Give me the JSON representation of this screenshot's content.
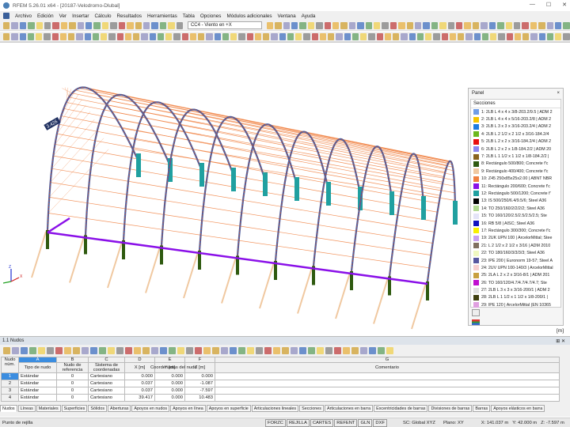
{
  "window": {
    "title": "RFEM 5.26.01 x64 - [20187-Velodromo-Dlubal]"
  },
  "menu": [
    "Archivo",
    "Edición",
    "Ver",
    "Insertar",
    "Cálculo",
    "Resultados",
    "Herramientas",
    "Tabla",
    "Opciones",
    "Módulos adicionales",
    "Ventana",
    "Ayuda"
  ],
  "toolbar": {
    "load_case": "CC4 - Viento en +X"
  },
  "viewport": {
    "units": "[m]",
    "dimension_label": "3.426"
  },
  "panel": {
    "title": "Panel",
    "close": "×",
    "heading": "Secciones",
    "sections": [
      {
        "label": "1: 2LB L 4 x 4 x 3/8-203.2/9.5 | ADM 2",
        "color": "#6f9de8"
      },
      {
        "label": "2: 2LB L 4 x 4 x 5/16-203.2/8 | ADM 2",
        "color": "#f5c400"
      },
      {
        "label": "3: 2LB L 3 x 3 x 3/16-203.2/4 | ADM 2",
        "color": "#1e7be0"
      },
      {
        "label": "4: 2LB L 2 1/2 x 2 1/2 x 3/16-184.2/4",
        "color": "#6cb81e"
      },
      {
        "label": "5: 2LB L 2 x 2 x 3/16-184.2/4 | ADM 2",
        "color": "#e81010"
      },
      {
        "label": "6: 2LB L 2 x 2 x 1/8-184.2/2 | ADM 20",
        "color": "#8c86f0"
      },
      {
        "label": "7: 2LB L 1 1/2 x 1 1/2 x 1/8-184.2/2 |",
        "color": "#8a6420"
      },
      {
        "label": "8: Rectángulo 500/800; Concrete f'c",
        "color": "#2f5a10"
      },
      {
        "label": "9: Rectángulo 400/400; Concrete f'c",
        "color": "#f0c8a0"
      },
      {
        "label": "10: Z45 250x85x25x2.00 | ABNT NBR",
        "color": "#f08040"
      },
      {
        "label": "11: Rectángulo 200/600; Concrete f'c",
        "color": "#8a10e8"
      },
      {
        "label": "12: Rectángulo 500/1200; Concrete f'",
        "color": "#20a0a0"
      },
      {
        "label": "13: IS 500/250/6.4/9.5/6; Steel A36",
        "color": "#000000"
      },
      {
        "label": "14: TO 250/160/2/2/2/2; Steel A36",
        "color": "#b0d890"
      },
      {
        "label": "15: TO 160/120/2.5/2.5/2.5/2.5; Ste",
        "color": "#e4e4f8"
      },
      {
        "label": "16: RB 5/8 | AISC; Steel A36",
        "color": "#1010c0"
      },
      {
        "label": "17: Rectángulo 300/300; Concrete f'c",
        "color": "#f8f000"
      },
      {
        "label": "19: 2UK UPN 100 | ArcelorMittal; Stee",
        "color": "#c8a0f0"
      },
      {
        "label": "21: L 2 1/2 x 2 1/2 x 3/16 | ADM 2010",
        "color": "#807060"
      },
      {
        "label": "22: TO 180/160/3/3/3/3; Steel A36",
        "color": "#f0f8c0"
      },
      {
        "label": "23: IPE 200 | Euronorm 19-57; Steel A",
        "color": "#5858a0"
      },
      {
        "label": "24: 2UV UPN 100-140/3 | ArcelorMittal",
        "color": "#f8d0d0"
      },
      {
        "label": "25: 2LA L 2 x 2 x 3/16-8/1 | ADM 201",
        "color": "#c8a040"
      },
      {
        "label": "26: TO 160/120/4.7/4.7/4.7/4.7; Ste",
        "color": "#c010d0"
      },
      {
        "label": "27: 2LB L 3 x 3 x 3/16-200/1 | ADM 2",
        "color": "#e0e0e0"
      },
      {
        "label": "28: 2LB L 1 1/2 x 1 1/2 x 1/8-200/1 |",
        "color": "#404010"
      },
      {
        "label": "29: IPE 120 | ArcelorMittal (EN 10365",
        "color": "#e0a0e0"
      }
    ]
  },
  "table": {
    "title": "1.1 Nudos",
    "col_letters": [
      "A",
      "B",
      "C",
      "D",
      "E",
      "F",
      "G"
    ],
    "headers": {
      "node_no": "Nudo núm.",
      "type": "Tipo de nudo",
      "ref": "Nudo de referencia",
      "coord_sys": "Sistema de coordenadas",
      "coords": "Coordenadas del nudo",
      "x": "X [m]",
      "y": "Y [m]",
      "z": "Z [m]",
      "comment": "Comentario"
    },
    "rows": [
      {
        "no": "1",
        "type": "Estándar",
        "ref": "0",
        "sys": "Cartesiano",
        "x": "0.000",
        "y": "0.000",
        "z": "0.000",
        "comment": ""
      },
      {
        "no": "2",
        "type": "Estándar",
        "ref": "0",
        "sys": "Cartesiano",
        "x": "0.037",
        "y": "0.000",
        "z": "-1.087",
        "comment": ""
      },
      {
        "no": "3",
        "type": "Estándar",
        "ref": "0",
        "sys": "Cartesiano",
        "x": "0.037",
        "y": "0.000",
        "z": "-7.597",
        "comment": ""
      },
      {
        "no": "4",
        "type": "Estándar",
        "ref": "0",
        "sys": "Cartesiano",
        "x": "39.417",
        "y": "0.000",
        "z": "10.483",
        "comment": ""
      }
    ],
    "tabs": [
      "Nudos",
      "Líneas",
      "Materiales",
      "Superficies",
      "Sólidos",
      "Aberturas",
      "Apoyos en nudos",
      "Apoyos en línea",
      "Apoyos en superficie",
      "Articulaciones lineales",
      "Secciones",
      "Articulaciones en barra",
      "Excentricidades de barras",
      "Divisiones de barras",
      "Barras",
      "Apoyos elásticos en barra"
    ]
  },
  "status": {
    "left": "Punto de rejilla",
    "buttons": [
      "FORZC",
      "REJILLA",
      "CARTES",
      "REFENT",
      "GLN",
      "DXF"
    ],
    "sc": "SC: Global XYZ",
    "plane": "Plano: XY",
    "x": "X: 141.037 m",
    "y": "Y: 42.000 m",
    "z": "Z: -7.597 m"
  },
  "colors": {
    "arch": "#5060a0",
    "purlin": "#f08040",
    "column": "#2f5a10",
    "beam": "#8a10e8",
    "pier": "#20a0a0",
    "pile": "#f0c8a0"
  }
}
